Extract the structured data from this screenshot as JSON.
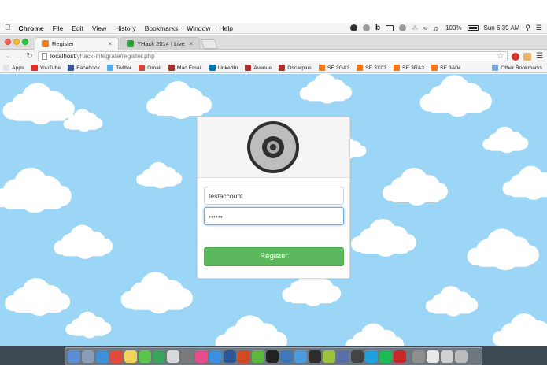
{
  "menubar": {
    "app_name": "Chrome",
    "items": [
      "File",
      "Edit",
      "View",
      "History",
      "Bookmarks",
      "Window",
      "Help"
    ],
    "battery": "100%",
    "clock": "Sun 6:39 AM"
  },
  "tabs": [
    {
      "label": "Register",
      "favicon_color": "#f07a1a",
      "close": "×"
    },
    {
      "label": "YHack 2014 | Live",
      "favicon_color": "#2aa43a",
      "close": "×"
    }
  ],
  "address": {
    "host": "localhost",
    "path": "/yhack-integrate/register.php"
  },
  "bookmarks": [
    {
      "label": "Apps",
      "color": "#e5e5e5"
    },
    {
      "label": "YouTube",
      "color": "#e52d27"
    },
    {
      "label": "Facebook",
      "color": "#3b5998"
    },
    {
      "label": "Twitter",
      "color": "#55acee"
    },
    {
      "label": "Gmail",
      "color": "#d44638"
    },
    {
      "label": "Mac Email",
      "color": "#a8342e"
    },
    {
      "label": "LinkedIn",
      "color": "#0077b5"
    },
    {
      "label": "Avenue",
      "color": "#a8342e"
    },
    {
      "label": "Oscarplus",
      "color": "#a8342e"
    },
    {
      "label": "SE 3GA3",
      "color": "#f07a1a"
    },
    {
      "label": "SE 3X03",
      "color": "#f07a1a"
    },
    {
      "label": "SE 3RA3",
      "color": "#f07a1a"
    },
    {
      "label": "SE 3A04",
      "color": "#f07a1a"
    }
  ],
  "other_bookmarks": "Other Bookmarks",
  "form": {
    "username_value": "testaccount",
    "password_value": "••••••",
    "register_label": "Register"
  },
  "colors": {
    "sky": "#9cd6f6",
    "button": "#5cb85c",
    "focus": "#66afe9"
  },
  "dock_icons": [
    "finder-icon",
    "launchpad-icon",
    "safari-icon",
    "chrome-icon",
    "notes-icon",
    "messages-icon",
    "facetime-icon",
    "preview-icon",
    "photo-icon",
    "itunes-icon",
    "appstore-icon",
    "word-icon",
    "powerpoint-icon",
    "upwork-icon",
    "github-icon",
    "sourcetree-icon",
    "xcode-icon",
    "terminal-icon",
    "android-icon",
    "r-icon",
    "console-icon",
    "skype-icon",
    "spotify-icon",
    "filezilla-icon",
    "system-prefs-icon",
    "documents-icon",
    "downloads-icon",
    "trash-icon"
  ]
}
